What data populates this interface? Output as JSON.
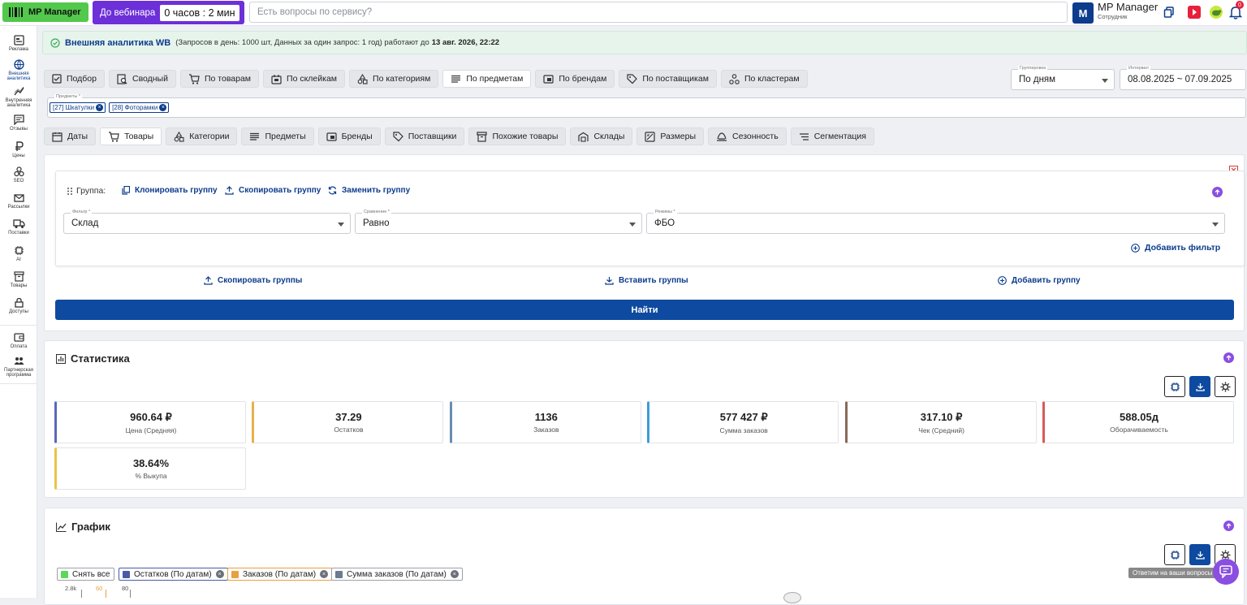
{
  "header": {
    "logo_text": "MP Manager",
    "webinar_label": "До вебинара",
    "webinar_timer": "0 часов : 2 мин",
    "search_placeholder": "Есть вопросы по сервису?",
    "avatar_letter": "M",
    "user_name": "MP Manager",
    "user_role": "Сотрудник",
    "notification_count": "0"
  },
  "sidebar": {
    "items": [
      {
        "label": "Реклама",
        "icon": "ad-icon"
      },
      {
        "label": "Внешняя аналитика",
        "icon": "globe-icon"
      },
      {
        "label": "Внутренняя аналитика",
        "icon": "trend-icon"
      },
      {
        "label": "Отзывы",
        "icon": "comment-icon"
      },
      {
        "label": "Цены",
        "icon": "ruble-icon"
      },
      {
        "label": "SEO",
        "icon": "seo-icon"
      },
      {
        "label": "Рассылки",
        "icon": "mail-icon"
      },
      {
        "label": "Поставки",
        "icon": "truck-icon"
      },
      {
        "label": "AI",
        "icon": "chip-icon"
      },
      {
        "label": "Товары",
        "icon": "box-icon"
      },
      {
        "label": "Доступы",
        "icon": "lock-icon"
      },
      {
        "label": "Оплата",
        "icon": "wallet-icon"
      },
      {
        "label": "Партнерская программа",
        "icon": "people-icon"
      }
    ]
  },
  "notice": {
    "title": "Внешняя аналитика WB",
    "text": "(Запросов в день: 1000 шт, Данных за один запрос: 1 год) работают до",
    "until": "13 авг. 2026, 22:22"
  },
  "mode_tabs": [
    {
      "label": "Подбор",
      "icon": "check-square-icon"
    },
    {
      "label": "Сводный",
      "icon": "summary-icon"
    },
    {
      "label": "По товарам",
      "icon": "cart-icon"
    },
    {
      "label": "По склейкам",
      "icon": "glue-icon"
    },
    {
      "label": "По категориям",
      "icon": "shapes-icon"
    },
    {
      "label": "По предметам",
      "icon": "list-icon"
    },
    {
      "label": "По брендам",
      "icon": "brand-icon"
    },
    {
      "label": "По поставщикам",
      "icon": "tag-icon"
    },
    {
      "label": "По кластерам",
      "icon": "cluster-icon"
    }
  ],
  "grouping": {
    "label": "Группировка",
    "value": "По дням"
  },
  "interval": {
    "label": "Интервал",
    "value": "08.08.2025 ~ 07.09.2025"
  },
  "subjects": {
    "label": "Предметы *",
    "chips": [
      "[27] Шкатулки",
      "[28] Фоторамки"
    ]
  },
  "section_tabs": [
    {
      "label": "Даты",
      "icon": "calendar-icon"
    },
    {
      "label": "Товары",
      "icon": "cart-icon"
    },
    {
      "label": "Категории",
      "icon": "shapes-icon"
    },
    {
      "label": "Предметы",
      "icon": "list-icon"
    },
    {
      "label": "Бренды",
      "icon": "brand-icon"
    },
    {
      "label": "Поставщики",
      "icon": "tag-icon"
    },
    {
      "label": "Похожие товары",
      "icon": "archive-icon"
    },
    {
      "label": "Склады",
      "icon": "warehouse-icon"
    },
    {
      "label": "Размеры",
      "icon": "ruler-icon"
    },
    {
      "label": "Сезонность",
      "icon": "season-icon"
    },
    {
      "label": "Сегментация",
      "icon": "segment-icon"
    }
  ],
  "filter": {
    "group_label": "Группа:",
    "clone_group": "Клонировать группу",
    "copy_group": "Скопировать группу",
    "replace_group": "Заменить группу",
    "filter_label": "Фильтр *",
    "filter_value": "Склад",
    "compare_label": "Сравнение *",
    "compare_value": "Равно",
    "mode_label": "Режимы *",
    "mode_value": "ФБО",
    "add_filter": "Добавить фильтр",
    "copy_groups": "Скопировать группы",
    "paste_groups": "Вставить группы",
    "add_group": "Добавить группу",
    "find": "Найти"
  },
  "statistics": {
    "title": "Статистика",
    "cards": [
      {
        "value": "960.64 ₽",
        "label": "Цена (Средняя)",
        "color": "#5a6ab8"
      },
      {
        "value": "37.29",
        "label": "Остатков",
        "color": "#e8b04a"
      },
      {
        "value": "1136",
        "label": "Заказов",
        "color": "#6a8cb0"
      },
      {
        "value": "577 427 ₽",
        "label": "Сумма заказов",
        "color": "#3a9ed8"
      },
      {
        "value": "317.10 ₽",
        "label": "Чек (Средний)",
        "color": "#8a6a58"
      },
      {
        "value": "588.05д",
        "label": "Оборачиваемость",
        "color": "#d85a5a"
      },
      {
        "value": "38.64%",
        "label": "% Выкупа",
        "color": "#e8c44a"
      }
    ]
  },
  "chart": {
    "title": "График",
    "legend": [
      {
        "label": "Снять все",
        "color": "#5ad85a",
        "border": "#9aa0a8",
        "removable": false
      },
      {
        "label": "Остатков (По датам)",
        "color": "#4a5aa8",
        "border": "#4a5aa8",
        "removable": true
      },
      {
        "label": "Заказов (По датам)",
        "color": "#e8a040",
        "border": "#e8a040",
        "removable": true
      },
      {
        "label": "Сумма заказов (По датам)",
        "color": "#6a7a90",
        "border": "#9aa0a8",
        "removable": true
      }
    ],
    "axis_ticks": [
      "2.8k",
      "60",
      "80"
    ],
    "tooltip": "Ответим на ваши вопросы"
  }
}
